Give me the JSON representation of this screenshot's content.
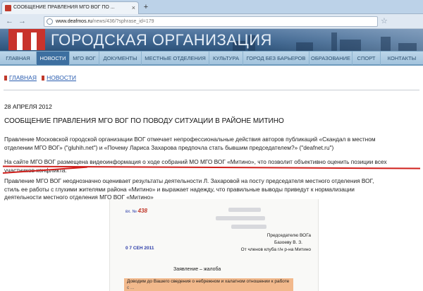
{
  "browser": {
    "tab_title": "СООБЩЕНИЕ ПРАВЛЕНИЯ МГО ВОГ ПО ...",
    "close_glyph": "×",
    "newtab_glyph": "+",
    "url_domain": "www.deafmos.ru",
    "url_path": "/news/436/?sphrase_id=179",
    "back_glyph": "←",
    "forward_glyph": "→",
    "star_glyph": "☆"
  },
  "site": {
    "banner_title": "ГОРОДСКАЯ ОРГАНИЗАЦИЯ",
    "menu": [
      "ГЛАВНАЯ",
      "НОВОСТИ",
      "МГО ВОГ",
      "ДОКУМЕНТЫ",
      "МЕСТНЫЕ ОТДЕЛЕНИЯ",
      "КУЛЬТУРА",
      "ГОРОД БЕЗ БАРЬЕРОВ",
      "ОБРАЗОВАНИЕ",
      "СПОРТ",
      "КОНТАКТЫ"
    ],
    "active_menu": "НОВОСТИ"
  },
  "breadcrumb": {
    "home": "ГЛАВНАЯ",
    "section": "НОВОСТИ"
  },
  "article": {
    "date": "28 АПРЕЛЯ 2012",
    "headline": "СООБЩЕНИЕ ПРАВЛЕНИЯ МГО ВОГ ПО ПОВОДУ СИТУАЦИИ В РАЙОНЕ МИТИНО",
    "p1_line1": "Правление Московской городской организации ВОГ отмечает непрофессиональные действия авторов публикаций «Скандал в местном",
    "p1_line2": "отделении МГО ВОГ» (\"gluhih.net\") и «Почему Лариса Захарова предпочла стать бывшим председателем?» (\"deafnet.ru\")",
    "p2_line1": "На сайте МГО ВОГ размещена видеоинформация о ходе собраний МО МГО ВОГ «Митино», что позволит объективно оценить позиции всех",
    "p2_line2": "участников конфликта.",
    "p3_line1": "Правление МГО ВОГ неоднозначно оценивает результаты деятельности Л. Захаровой на посту председателя местного отделения ВОГ,",
    "p3_line2": "стиль ее работы с глухими жителями района «Митино» и выражает надежду, что правильные выводы приведут к нормализации",
    "p3_line3": "деятельности местного отделения МГО ВОГ «Митино»"
  },
  "scan": {
    "stamp_prefix": "вх. №",
    "stamp_number": "438",
    "stamp_date": "0 7  СЕН  2011",
    "addr1": "Председателю ВОГа",
    "addr2": "Базоеву В. З.",
    "addr3": "От членов клуба г/н р-на Митино",
    "doc_title": "Заявление – жалоба",
    "body1": "Доводим до Вашего сведения о небрежном и халатном отношении к работе",
    "body2": "с ..."
  },
  "colors": {
    "accent_red": "#c0392b",
    "menu_active": "#3d6fa0",
    "link": "#2a5db0",
    "annotation_red": "#d0201c"
  }
}
